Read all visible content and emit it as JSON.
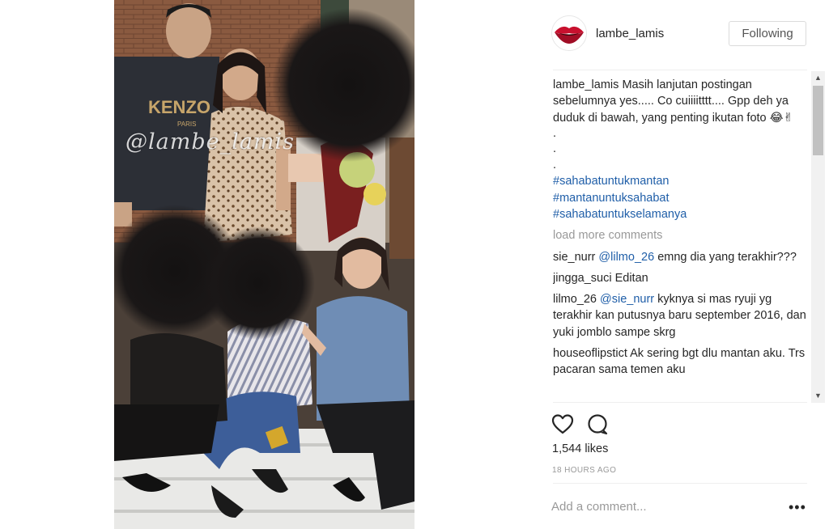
{
  "post": {
    "watermark": "@lambe_lamis",
    "author": {
      "username": "lambe_lamis",
      "follow_label": "Following"
    },
    "caption": {
      "username": "lambe_lamis",
      "text": "Masih lanjutan postingan sebelumnya yes..... Co cuiiiitttt.... Gpp deh ya duduk di bawah, yang penting ikutan foto 😂✌",
      "dots": [
        ".",
        ".",
        "."
      ],
      "hashtags": [
        "#sahabatuntukmantan",
        "#mantanuntuksahabat",
        "#sahabatuntukselamanya"
      ]
    },
    "load_more_label": "load more comments",
    "comments": [
      {
        "user": "sie_nurr",
        "mention": "@lilmo_26",
        "text": "emng dia yang terakhir???"
      },
      {
        "user": "jingga_suci",
        "mention": "",
        "text": "Editan"
      },
      {
        "user": "lilmo_26",
        "mention": "@sie_nurr",
        "text": "kyknya si mas ryuji yg terakhir kan putusnya baru september 2016, dan yuki jomblo sampe skrg"
      },
      {
        "user": "houseoflipstict",
        "mention": "",
        "text": "Ak sering bgt dlu mantan aku. Trs pacaran sama temen aku"
      }
    ],
    "likes": "1,544 likes",
    "timestamp": "18 HOURS AGO",
    "comment_placeholder": "Add a comment...",
    "more_options": "•••"
  },
  "icons": {
    "like": "heart-icon",
    "comment": "speech-bubble-icon",
    "more": "more-options-icon",
    "scroll_up": "scroll-up-icon",
    "scroll_down": "scroll-down-icon"
  },
  "colors": {
    "link": "#1f5ea8",
    "muted": "#999999",
    "text": "#262626",
    "divider": "#efefef"
  }
}
